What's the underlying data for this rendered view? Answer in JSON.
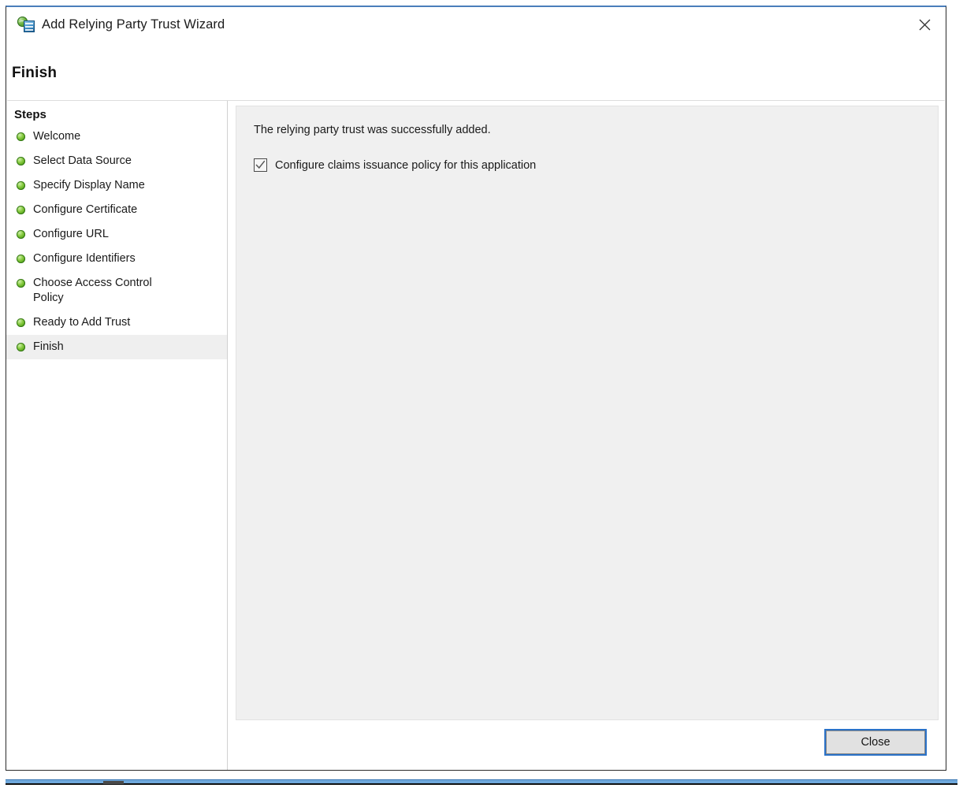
{
  "window": {
    "title": "Add Relying Party Trust Wizard",
    "app_icon": "adfs-relying-party-icon",
    "close_icon": "close-icon",
    "page_heading": "Finish"
  },
  "sidebar": {
    "heading": "Steps",
    "items": [
      {
        "label": "Welcome",
        "state": "complete"
      },
      {
        "label": "Select Data Source",
        "state": "complete"
      },
      {
        "label": "Specify Display Name",
        "state": "complete"
      },
      {
        "label": "Configure Certificate",
        "state": "complete"
      },
      {
        "label": "Configure URL",
        "state": "complete"
      },
      {
        "label": "Configure Identifiers",
        "state": "complete"
      },
      {
        "label": "Choose Access Control\nPolicy",
        "state": "complete"
      },
      {
        "label": "Ready to Add Trust",
        "state": "complete"
      },
      {
        "label": "Finish",
        "state": "current"
      }
    ]
  },
  "content": {
    "message": "The relying party trust was successfully added.",
    "checkbox": {
      "label": "Configure claims issuance policy for this application",
      "checked": true
    }
  },
  "footer": {
    "close_label": "Close"
  },
  "colors": {
    "accent": "#2a72c8",
    "title_border": "#4a7ebb",
    "panel_bg": "#f0f0f0",
    "step_complete": "#55a51c",
    "current_step_bg": "#efefef"
  }
}
